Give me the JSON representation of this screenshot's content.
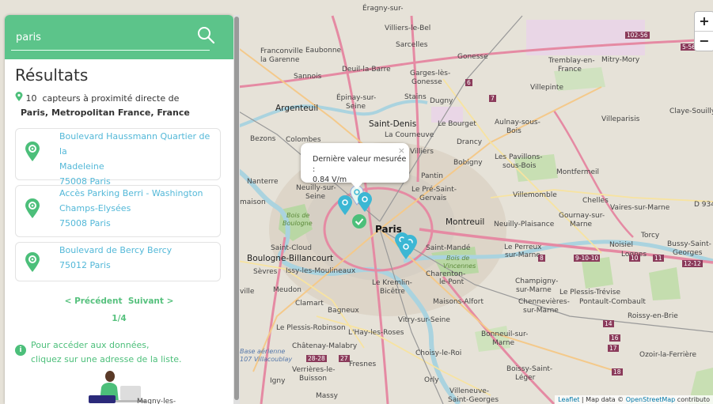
{
  "search": {
    "value": "paris",
    "button_icon": "magnifier-icon"
  },
  "results": {
    "title": "Résultats",
    "count": "10",
    "count_text": "capteurs à proximité directe de",
    "place": "Paris, Metropolitan France, France",
    "items": [
      {
        "line1": "Boulevard Haussmann Quartier de la",
        "line2": "Madeleine",
        "line3": "75008 Paris"
      },
      {
        "line1": "Accès Parking Berri - Washington",
        "line2": "Champs-Elysées",
        "line3": "75008 Paris"
      },
      {
        "line1": "Boulevard de Bercy Bercy",
        "line2": "75012 Paris",
        "line3": ""
      }
    ],
    "prev": "< Précédent",
    "next": "Suivant >",
    "page": "1/4",
    "info_line1": "Pour accéder aux données,",
    "info_line2": "cliquez sur une adresse de la liste."
  },
  "popup": {
    "line1": "Dernière valeur mesurée :",
    "line2": "0.84 V/m",
    "close": "×"
  },
  "zoom": {
    "plus": "+",
    "minus": "−"
  },
  "attribution": {
    "leaflet": "Leaflet",
    "sep": " | Map data © ",
    "osm": "OpenStreetMap",
    "rest": " contributo"
  },
  "colors": {
    "accent": "#5cc48a",
    "link": "#53b8d8",
    "marker": "#3cb7d4",
    "marker_green": "#4cbf7a"
  },
  "map": {
    "labels": {
      "eragny": "Éragny-sur-",
      "villiers": "Villiers-le-Bel",
      "sarcelles": "Sarcelles",
      "franconville": "Franconville",
      "eaubonne": "Eaubonne",
      "lagarenne": "la Garenne",
      "deuil": "Deuil-la-Barre",
      "garges": "Garges-lès-",
      "gonesse1": "Gonesse",
      "gonesse2": "Gonesse",
      "tremblay": "Tremblay-en-",
      "france": "France",
      "mitry": "Mitry-Mory",
      "sannois": "Sannois",
      "villepinte": "Villepinte",
      "epinay": "Épinay-sur-",
      "seine1": "Seine",
      "stains": "Stains",
      "dugny": "Dugny",
      "argenteuil": "Argenteuil",
      "claye": "Claye-Souilly",
      "villeparisis": "Villeparisis",
      "aulnay": "Aulnay-sous-",
      "bois": "Bois",
      "saintdenis": "Saint-Denis",
      "lebourget": "Le Bourget",
      "bezons": "Bezons",
      "colombes": "Colombes",
      "courneuve": "La Courneuve",
      "drancy": "Drancy",
      "villiers2": "Villiers",
      "bobigny": "Bobigny",
      "pavillons": "Les Pavillons-",
      "sousbois": "sous-Bois",
      "montfermeil": "Montfermeil",
      "nanterre": "Nanterre",
      "pantin": "Pantin",
      "neuilly": "Neuilly-sur-",
      "seine2": "Seine",
      "presaint": "Le Pré-Saint-",
      "gervais": "Gervais",
      "villemomble": "Villemomble",
      "chelles": "Chelles",
      "vairessur": "Vaires-sur-Marne",
      "d934": "D 934",
      "maison": "maison",
      "boisdeb": "Bois de",
      "boulogne": "Boulogne",
      "paris": "Paris",
      "montreuil": "Montreuil",
      "neuillyp": "Neuilly-Plaisance",
      "gournay": "Gournay-sur-",
      "marne1": "Marne",
      "torcy": "Torcy",
      "bussy": "Bussy-Saint-",
      "georges": "Georges",
      "saintcloud": "Saint-Cloud",
      "saintmande": "Saint-Mandé",
      "leperreux": "Le Perreux",
      "surmarne": "sur-Marne",
      "noisiel": "Noisiel",
      "lognes": "Lognes",
      "boulognebill": "Boulogne-Billancourt",
      "boisdev": "Bois de",
      "vincennes": "Vincennes",
      "sevres": "Sèvres",
      "issy": "Issy-les-Moulineaux",
      "charenton": "Charenton-",
      "lepont": "le-Pont",
      "champigny": "Champigny-",
      "surmarne2": "sur-Marne",
      "plessistrev": "Le Plessis-Trévise",
      "ville": "ville",
      "meudon": "Meudon",
      "kremlin": "Le Kremlin-",
      "bicetre": "Bicêtre",
      "pontault": "Pontault-Combault",
      "clamart": "Clamart",
      "maisonsalfort": "Maisons-Alfort",
      "chennevieres": "Chennevières-",
      "surmarne3": "sur-Marne",
      "roissy": "Roissy-en-Brie",
      "bagneux": "Bagneux",
      "vitry": "Vitry-sur-Seine",
      "plessisrob": "Le Plessis-Robinson",
      "hay": "L'Hay-les-Roses",
      "bonneuil": "Bonneuil-sur-",
      "marne2": "Marne",
      "base": "Base aérienne",
      "villacoublay": "107 Villacoublay",
      "chatenay": "Châtenay-Malabry",
      "choisy": "Choisy-le-Roi",
      "ozoir": "Ozoir-la-Ferrière",
      "fresnes": "Fresnes",
      "verrieres": "Verrières-le-",
      "buisson": "Buisson",
      "boissy": "Boissy-Saint-",
      "leger": "Léger",
      "igny": "Igny",
      "orly": "Orly",
      "massy": "Massy",
      "villeneuve": "Villeneuve-",
      "saintgeorges": "Saint-Georges",
      "magny": "Magny-les-",
      "r1": "102-56",
      "r2": "5-56",
      "r3": "6",
      "r4": "7",
      "r5": "8",
      "r6": "9-10-10",
      "r7": "10",
      "r8": "11",
      "r9": "12-12",
      "r10": "14",
      "r11": "16",
      "r12": "17",
      "r13": "18",
      "r14": "28-28",
      "r15": "27"
    }
  }
}
